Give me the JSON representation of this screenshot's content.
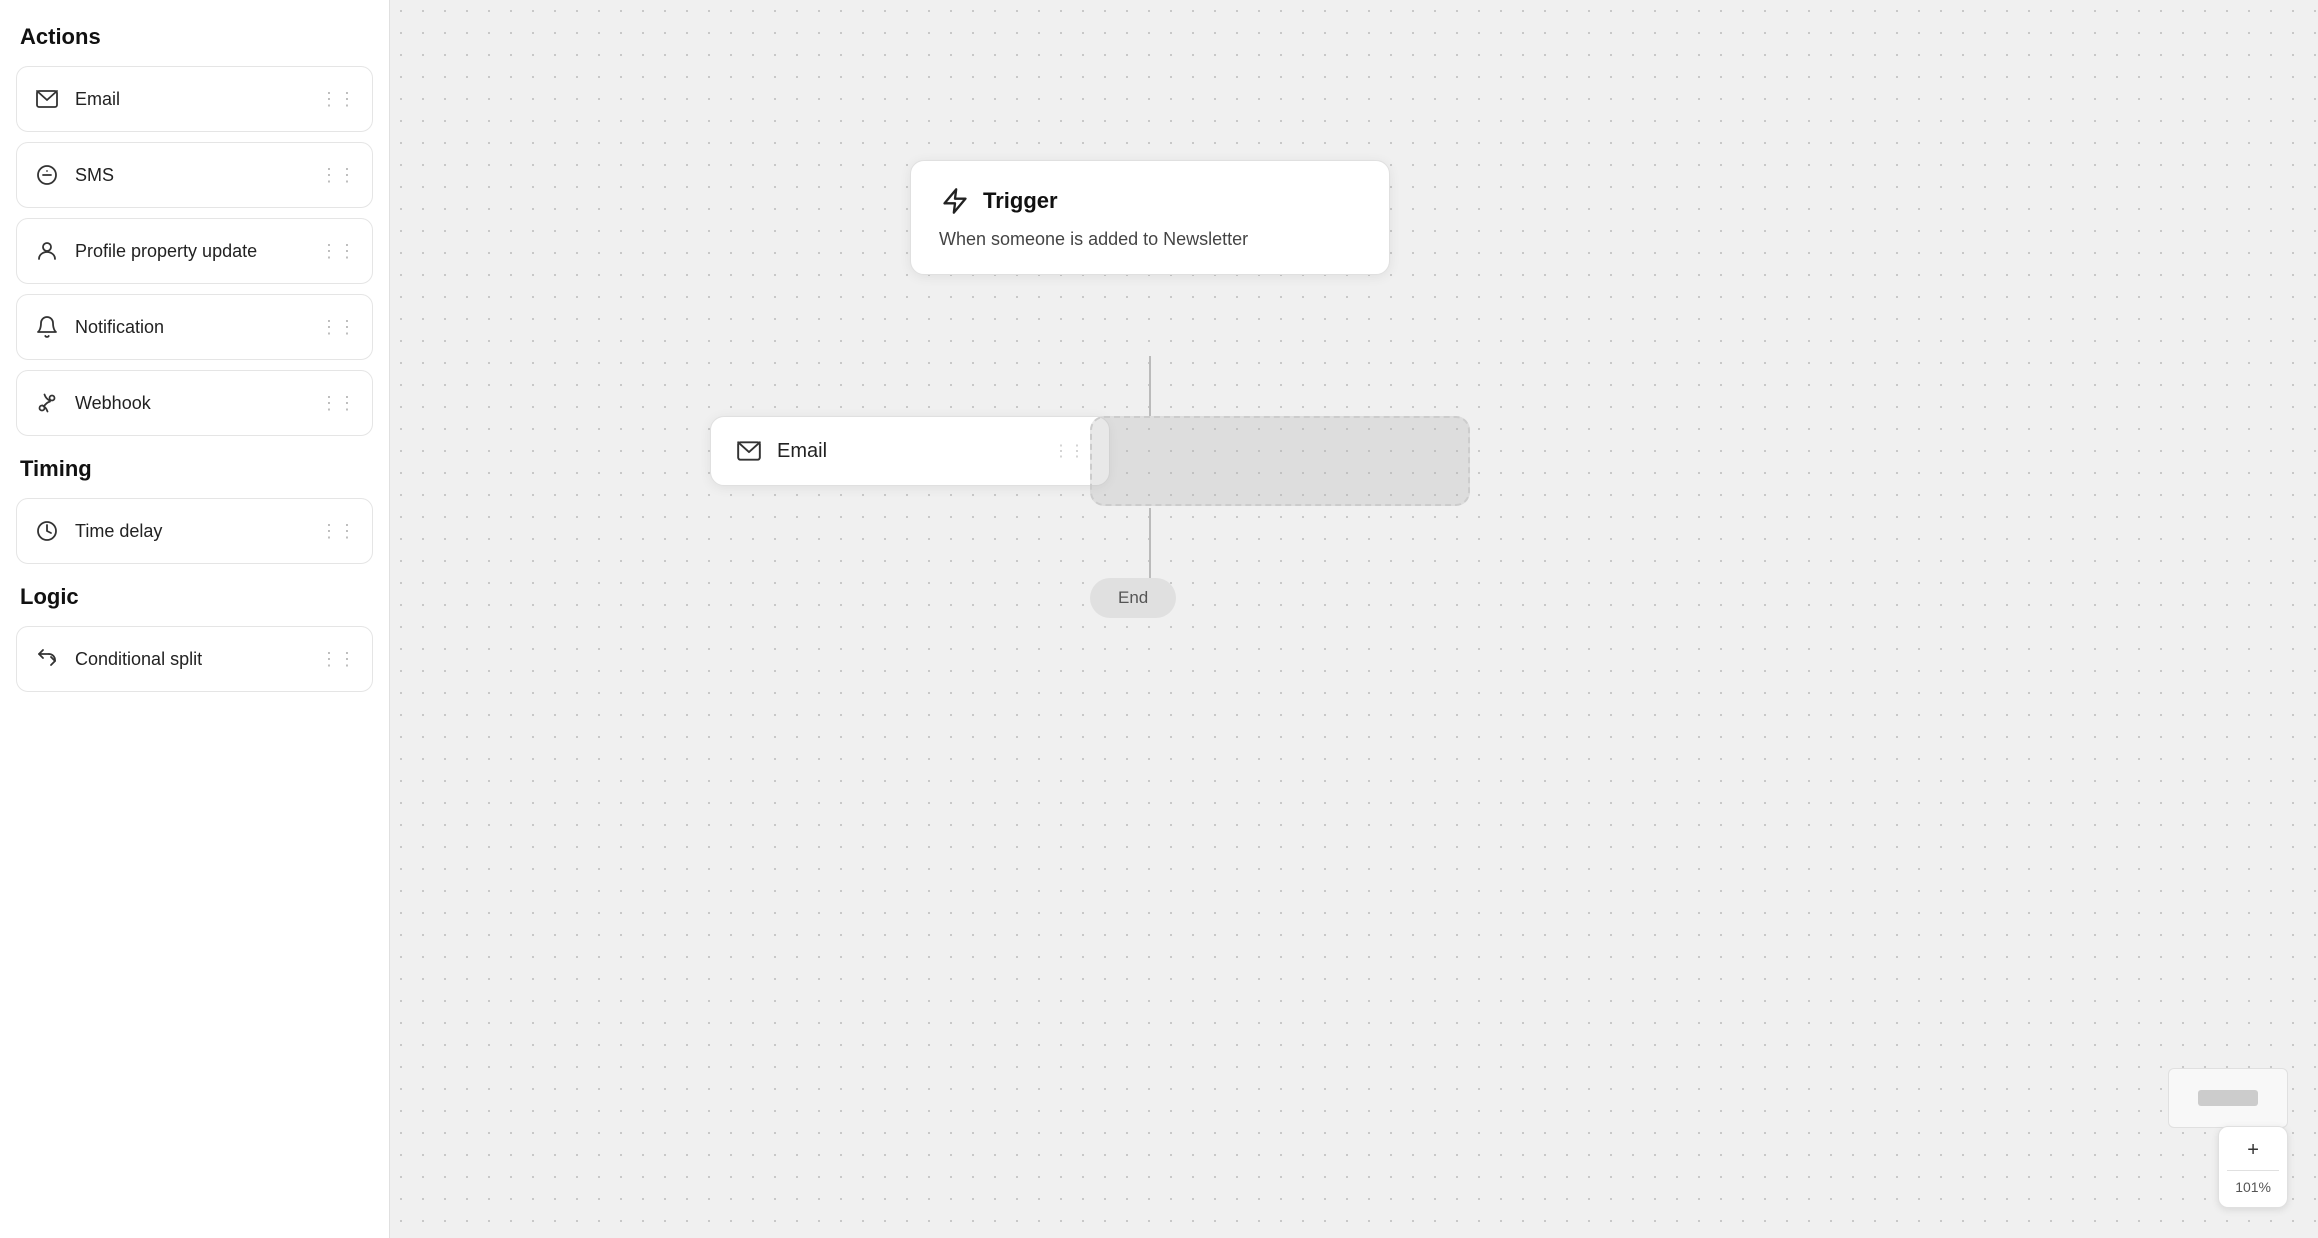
{
  "sidebar": {
    "sections": [
      {
        "id": "actions",
        "title": "Actions",
        "items": [
          {
            "id": "email",
            "label": "Email",
            "icon": "email-icon"
          },
          {
            "id": "sms",
            "label": "SMS",
            "icon": "sms-icon"
          },
          {
            "id": "profile-property-update",
            "label": "Profile property update",
            "icon": "profile-icon"
          },
          {
            "id": "notification",
            "label": "Notification",
            "icon": "notification-icon"
          },
          {
            "id": "webhook",
            "label": "Webhook",
            "icon": "webhook-icon"
          }
        ]
      },
      {
        "id": "timing",
        "title": "Timing",
        "items": [
          {
            "id": "time-delay",
            "label": "Time delay",
            "icon": "time-delay-icon"
          }
        ]
      },
      {
        "id": "logic",
        "title": "Logic",
        "items": [
          {
            "id": "conditional-split",
            "label": "Conditional split",
            "icon": "conditional-split-icon"
          }
        ]
      }
    ]
  },
  "canvas": {
    "trigger_node": {
      "title": "Trigger",
      "subtitle": "When someone is added to Newsletter"
    },
    "email_node": {
      "label": "Email"
    },
    "end_node": {
      "label": "End"
    }
  },
  "zoom": {
    "level": "101%",
    "plus_label": "+",
    "minus_label": "−"
  }
}
